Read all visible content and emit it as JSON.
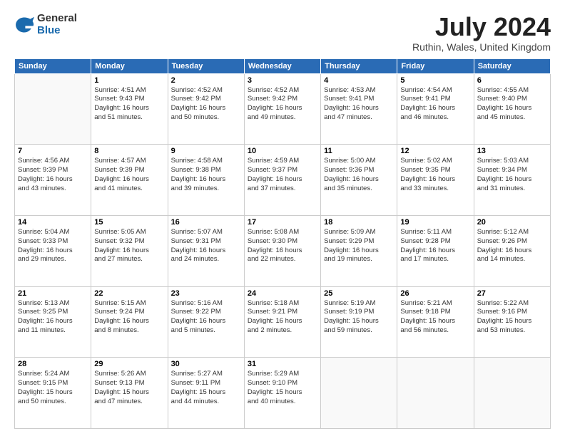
{
  "header": {
    "logo_general": "General",
    "logo_blue": "Blue",
    "month_title": "July 2024",
    "location": "Ruthin, Wales, United Kingdom"
  },
  "days_of_week": [
    "Sunday",
    "Monday",
    "Tuesday",
    "Wednesday",
    "Thursday",
    "Friday",
    "Saturday"
  ],
  "weeks": [
    [
      {
        "day": "",
        "info": ""
      },
      {
        "day": "1",
        "info": "Sunrise: 4:51 AM\nSunset: 9:43 PM\nDaylight: 16 hours\nand 51 minutes."
      },
      {
        "day": "2",
        "info": "Sunrise: 4:52 AM\nSunset: 9:42 PM\nDaylight: 16 hours\nand 50 minutes."
      },
      {
        "day": "3",
        "info": "Sunrise: 4:52 AM\nSunset: 9:42 PM\nDaylight: 16 hours\nand 49 minutes."
      },
      {
        "day": "4",
        "info": "Sunrise: 4:53 AM\nSunset: 9:41 PM\nDaylight: 16 hours\nand 47 minutes."
      },
      {
        "day": "5",
        "info": "Sunrise: 4:54 AM\nSunset: 9:41 PM\nDaylight: 16 hours\nand 46 minutes."
      },
      {
        "day": "6",
        "info": "Sunrise: 4:55 AM\nSunset: 9:40 PM\nDaylight: 16 hours\nand 45 minutes."
      }
    ],
    [
      {
        "day": "7",
        "info": "Sunrise: 4:56 AM\nSunset: 9:39 PM\nDaylight: 16 hours\nand 43 minutes."
      },
      {
        "day": "8",
        "info": "Sunrise: 4:57 AM\nSunset: 9:39 PM\nDaylight: 16 hours\nand 41 minutes."
      },
      {
        "day": "9",
        "info": "Sunrise: 4:58 AM\nSunset: 9:38 PM\nDaylight: 16 hours\nand 39 minutes."
      },
      {
        "day": "10",
        "info": "Sunrise: 4:59 AM\nSunset: 9:37 PM\nDaylight: 16 hours\nand 37 minutes."
      },
      {
        "day": "11",
        "info": "Sunrise: 5:00 AM\nSunset: 9:36 PM\nDaylight: 16 hours\nand 35 minutes."
      },
      {
        "day": "12",
        "info": "Sunrise: 5:02 AM\nSunset: 9:35 PM\nDaylight: 16 hours\nand 33 minutes."
      },
      {
        "day": "13",
        "info": "Sunrise: 5:03 AM\nSunset: 9:34 PM\nDaylight: 16 hours\nand 31 minutes."
      }
    ],
    [
      {
        "day": "14",
        "info": "Sunrise: 5:04 AM\nSunset: 9:33 PM\nDaylight: 16 hours\nand 29 minutes."
      },
      {
        "day": "15",
        "info": "Sunrise: 5:05 AM\nSunset: 9:32 PM\nDaylight: 16 hours\nand 27 minutes."
      },
      {
        "day": "16",
        "info": "Sunrise: 5:07 AM\nSunset: 9:31 PM\nDaylight: 16 hours\nand 24 minutes."
      },
      {
        "day": "17",
        "info": "Sunrise: 5:08 AM\nSunset: 9:30 PM\nDaylight: 16 hours\nand 22 minutes."
      },
      {
        "day": "18",
        "info": "Sunrise: 5:09 AM\nSunset: 9:29 PM\nDaylight: 16 hours\nand 19 minutes."
      },
      {
        "day": "19",
        "info": "Sunrise: 5:11 AM\nSunset: 9:28 PM\nDaylight: 16 hours\nand 17 minutes."
      },
      {
        "day": "20",
        "info": "Sunrise: 5:12 AM\nSunset: 9:26 PM\nDaylight: 16 hours\nand 14 minutes."
      }
    ],
    [
      {
        "day": "21",
        "info": "Sunrise: 5:13 AM\nSunset: 9:25 PM\nDaylight: 16 hours\nand 11 minutes."
      },
      {
        "day": "22",
        "info": "Sunrise: 5:15 AM\nSunset: 9:24 PM\nDaylight: 16 hours\nand 8 minutes."
      },
      {
        "day": "23",
        "info": "Sunrise: 5:16 AM\nSunset: 9:22 PM\nDaylight: 16 hours\nand 5 minutes."
      },
      {
        "day": "24",
        "info": "Sunrise: 5:18 AM\nSunset: 9:21 PM\nDaylight: 16 hours\nand 2 minutes."
      },
      {
        "day": "25",
        "info": "Sunrise: 5:19 AM\nSunset: 9:19 PM\nDaylight: 15 hours\nand 59 minutes."
      },
      {
        "day": "26",
        "info": "Sunrise: 5:21 AM\nSunset: 9:18 PM\nDaylight: 15 hours\nand 56 minutes."
      },
      {
        "day": "27",
        "info": "Sunrise: 5:22 AM\nSunset: 9:16 PM\nDaylight: 15 hours\nand 53 minutes."
      }
    ],
    [
      {
        "day": "28",
        "info": "Sunrise: 5:24 AM\nSunset: 9:15 PM\nDaylight: 15 hours\nand 50 minutes."
      },
      {
        "day": "29",
        "info": "Sunrise: 5:26 AM\nSunset: 9:13 PM\nDaylight: 15 hours\nand 47 minutes."
      },
      {
        "day": "30",
        "info": "Sunrise: 5:27 AM\nSunset: 9:11 PM\nDaylight: 15 hours\nand 44 minutes."
      },
      {
        "day": "31",
        "info": "Sunrise: 5:29 AM\nSunset: 9:10 PM\nDaylight: 15 hours\nand 40 minutes."
      },
      {
        "day": "",
        "info": ""
      },
      {
        "day": "",
        "info": ""
      },
      {
        "day": "",
        "info": ""
      }
    ]
  ]
}
